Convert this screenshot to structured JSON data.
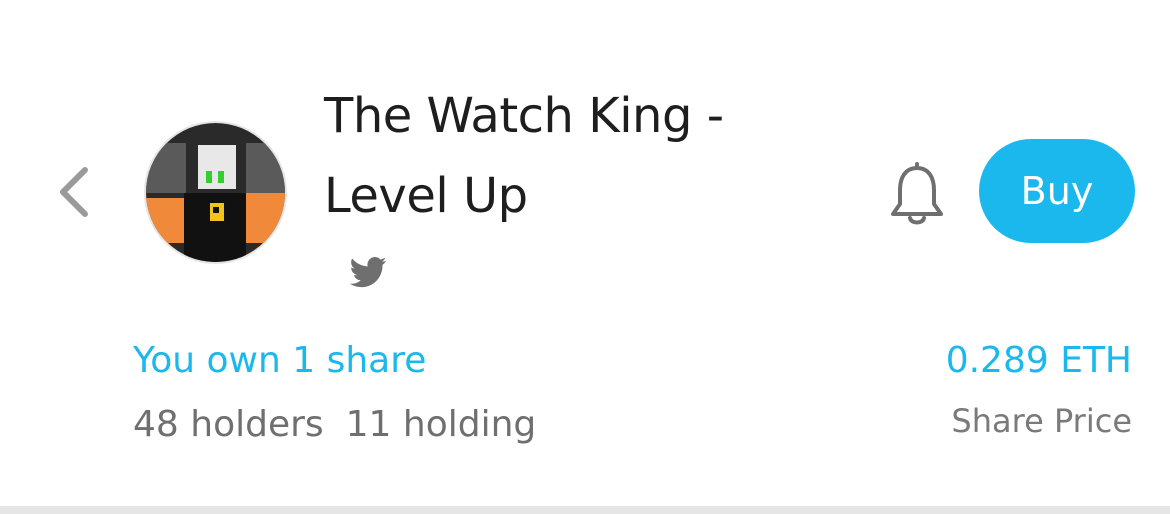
{
  "header": {
    "back_icon": "chevron-left-icon",
    "avatar_alt": "pixel art avatar",
    "title_line1": "The Watch King -",
    "title_line2": "Level Up",
    "social_icon": "twitter-icon",
    "bell_icon": "bell-icon",
    "buy_label": "Buy"
  },
  "ownership": {
    "own_text": "You own 1 share",
    "holders": "48 holders",
    "holding": "11 holding"
  },
  "pricing": {
    "price": "0.289 ETH",
    "price_label": "Share Price"
  },
  "colors": {
    "accent": "#1ab8ec",
    "title": "#1e1e1e",
    "muted": "#6f6f6f"
  }
}
